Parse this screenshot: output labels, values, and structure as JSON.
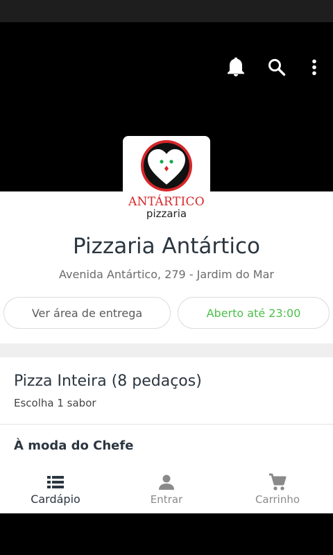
{
  "header": {
    "icons": [
      "bell-icon",
      "search-icon",
      "more-vert-icon"
    ]
  },
  "logo": {
    "brand": "ANTÁRTICO",
    "sub": "pizzaria",
    "colors": {
      "ring": "#d6262a",
      "eyes": "#1aa84b",
      "beak": "#d6262a"
    }
  },
  "store": {
    "name": "Pizzaria Antártico",
    "address": "Avenida Antártico, 279 - Jardim do Mar"
  },
  "actions": {
    "delivery_area": "Ver área de entrega",
    "open_status": "Aberto até 23:00",
    "open_color": "#4cc04a"
  },
  "section": {
    "title": "Pizza Inteira (8 pedaços)",
    "subtitle": "Escolha 1 sabor",
    "category": "À moda do Chefe"
  },
  "bottom_nav": {
    "items": [
      {
        "label": "Cardápio",
        "icon": "list-icon",
        "active": true
      },
      {
        "label": "Entrar",
        "icon": "person-icon",
        "active": false
      },
      {
        "label": "Carrinho",
        "icon": "cart-icon",
        "active": false
      }
    ]
  }
}
